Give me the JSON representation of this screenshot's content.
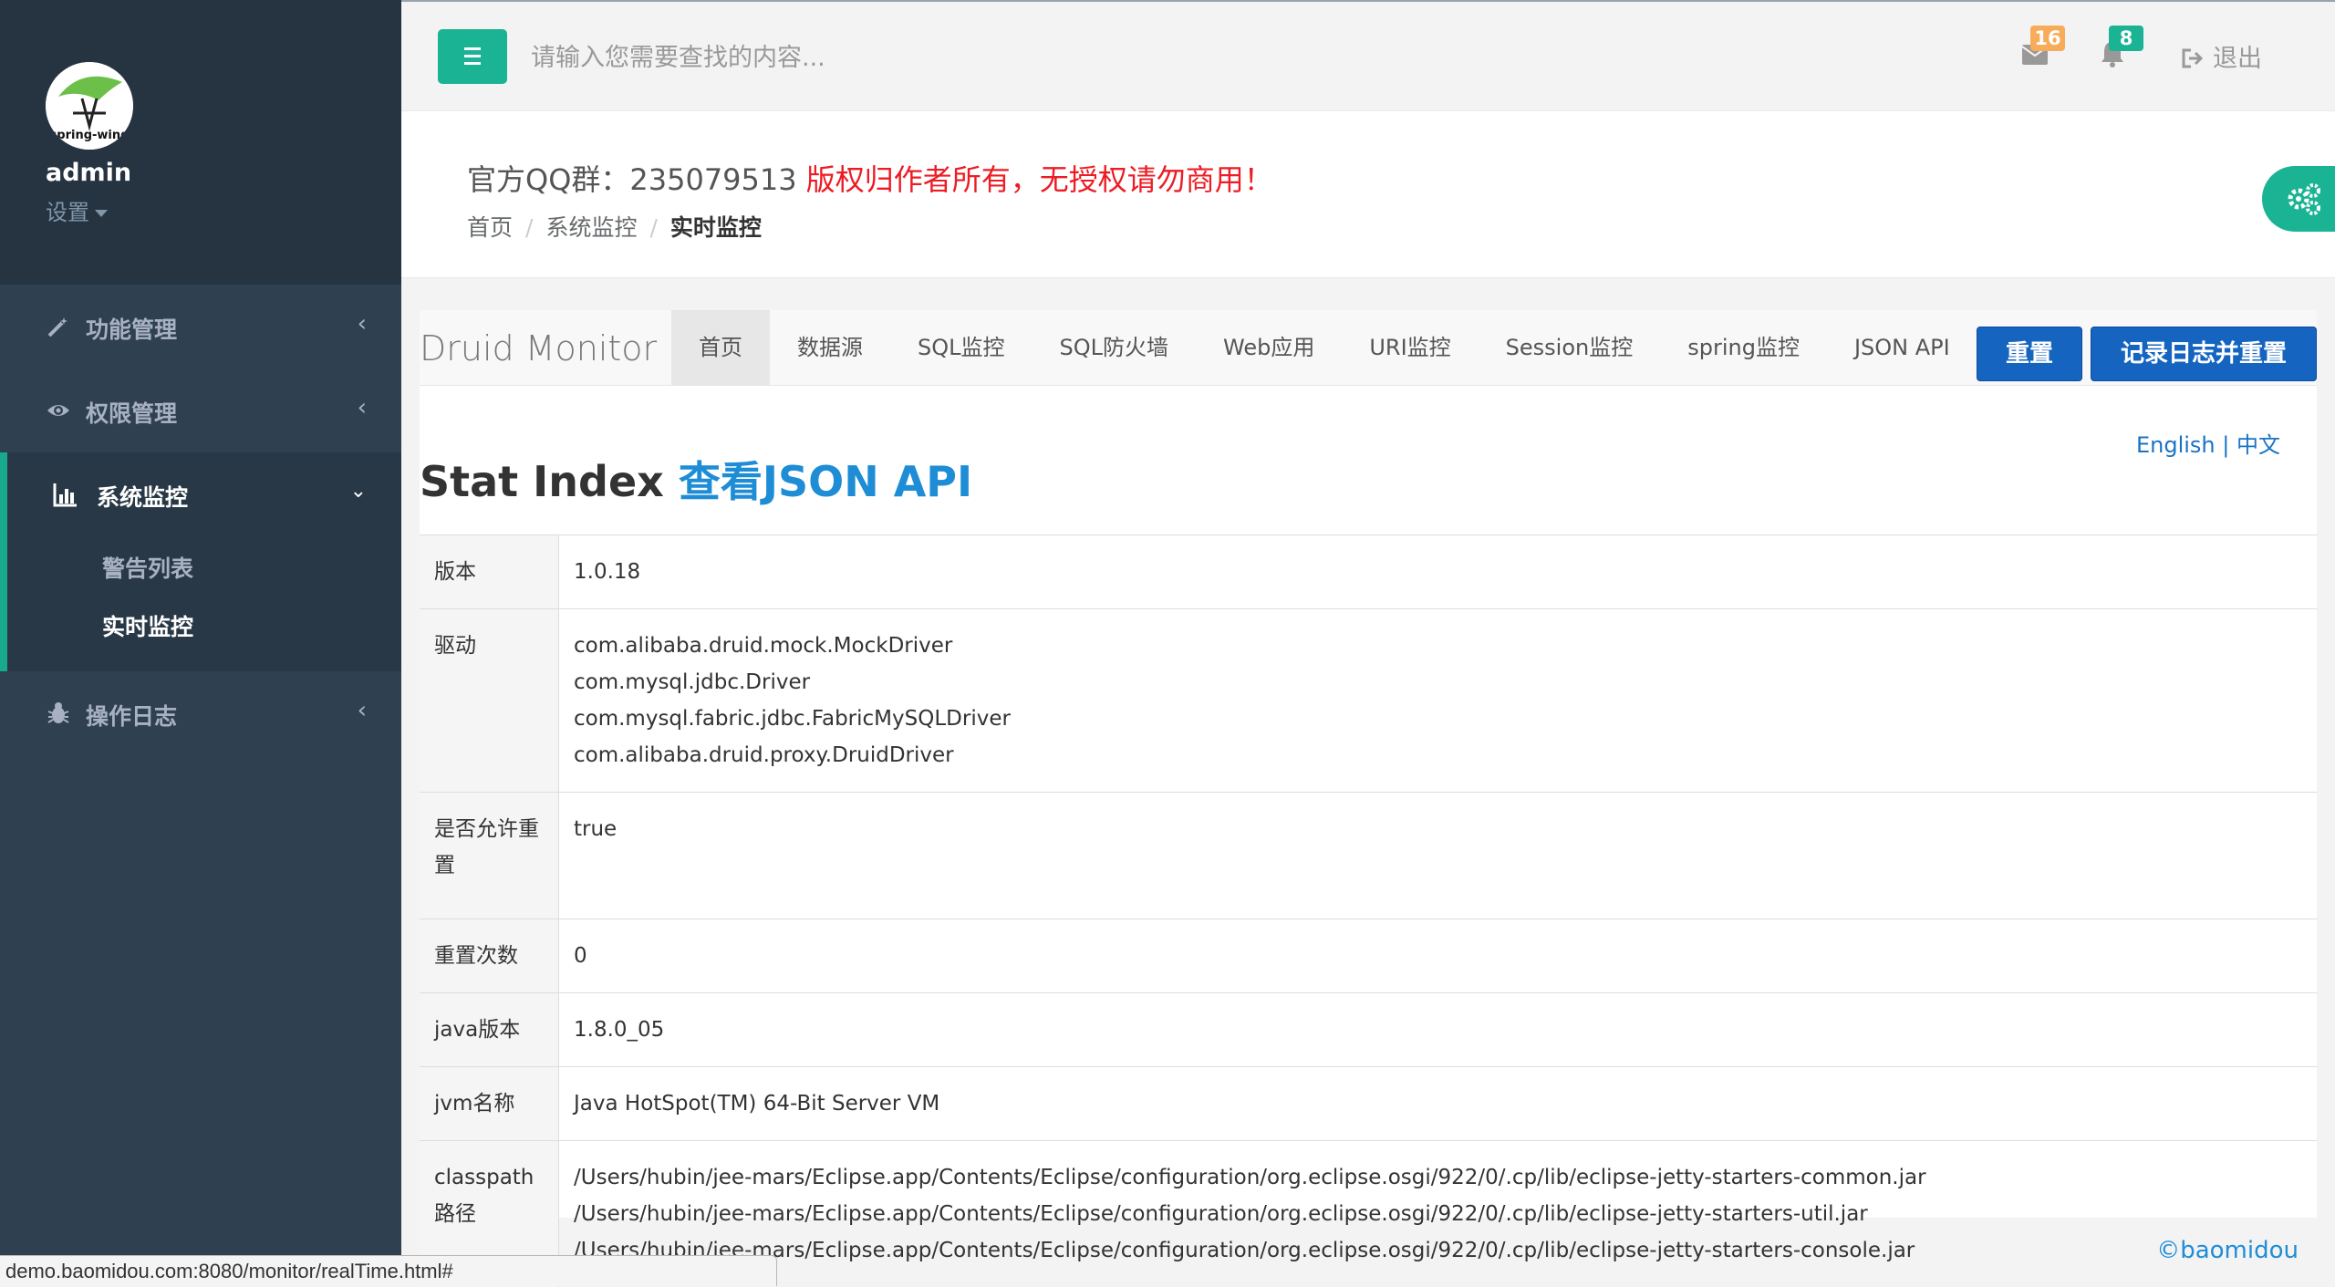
{
  "sidebar": {
    "username": "admin",
    "settings_label": "设置",
    "avatar_text": "spring-wind",
    "items": [
      {
        "label": "功能管理",
        "icon": "wand-icon"
      },
      {
        "label": "权限管理",
        "icon": "eye-icon"
      },
      {
        "label": "系统监控",
        "icon": "bar-chart-icon"
      },
      {
        "label": "操作日志",
        "icon": "bug-icon"
      }
    ],
    "sub_items": [
      {
        "label": "警告列表"
      },
      {
        "label": "实时监控"
      }
    ]
  },
  "topbar": {
    "search_placeholder": "请输入您需要查找的内容...",
    "mail_count": "16",
    "bell_count": "8",
    "logout_label": "退出"
  },
  "header": {
    "qq_text": "官方QQ群：235079513 ",
    "warning_text": "版权归作者所有，无授权请勿商用！",
    "breadcrumb": [
      "首页",
      "系统监控",
      "实时监控"
    ]
  },
  "druid": {
    "brand": "Druid Monitor",
    "tabs": [
      "首页",
      "数据源",
      "SQL监控",
      "SQL防火墙",
      "Web应用",
      "URI监控",
      "Session监控",
      "spring监控",
      "JSON API"
    ],
    "reset_label": "重置",
    "log_reset_label": "记录日志并重置",
    "lang_en": "English",
    "lang_sep": "|",
    "lang_zh": "中文",
    "title": "Stat Index ",
    "title_link": "查看JSON API",
    "rows": [
      {
        "key": "版本",
        "values": [
          "1.0.18"
        ]
      },
      {
        "key": "驱动",
        "values": [
          "com.alibaba.druid.mock.MockDriver",
          "com.mysql.jdbc.Driver",
          "com.mysql.fabric.jdbc.FabricMySQLDriver",
          "com.alibaba.druid.proxy.DruidDriver"
        ]
      },
      {
        "key": "是否允许重置",
        "values": [
          "true"
        ]
      },
      {
        "key": "重置次数",
        "values": [
          "0"
        ]
      },
      {
        "key": "java版本",
        "values": [
          "1.8.0_05"
        ]
      },
      {
        "key": "jvm名称",
        "values": [
          "Java HotSpot(TM) 64-Bit Server VM"
        ]
      },
      {
        "key": "classpath路径",
        "values": [
          "/Users/hubin/jee-mars/Eclipse.app/Contents/Eclipse/configuration/org.eclipse.osgi/922/0/.cp/lib/eclipse-jetty-starters-common.jar",
          "/Users/hubin/jee-mars/Eclipse.app/Contents/Eclipse/configuration/org.eclipse.osgi/922/0/.cp/lib/eclipse-jetty-starters-util.jar",
          "/Users/hubin/jee-mars/Eclipse.app/Contents/Eclipse/configuration/org.eclipse.osgi/922/0/.cp/lib/eclipse-jetty-starters-console.jar"
        ]
      }
    ]
  },
  "footer": {
    "copyright": "©baomidou"
  },
  "status_url": "demo.baomidou.com:8080/monitor/realTime.html#",
  "colors": {
    "sidebar": "#2f4050",
    "accent": "#1ab394",
    "primary_button": "#1565c0",
    "warning": "#ed1c24",
    "mail_badge": "#f8ac59",
    "bell_badge": "#1ab394"
  }
}
